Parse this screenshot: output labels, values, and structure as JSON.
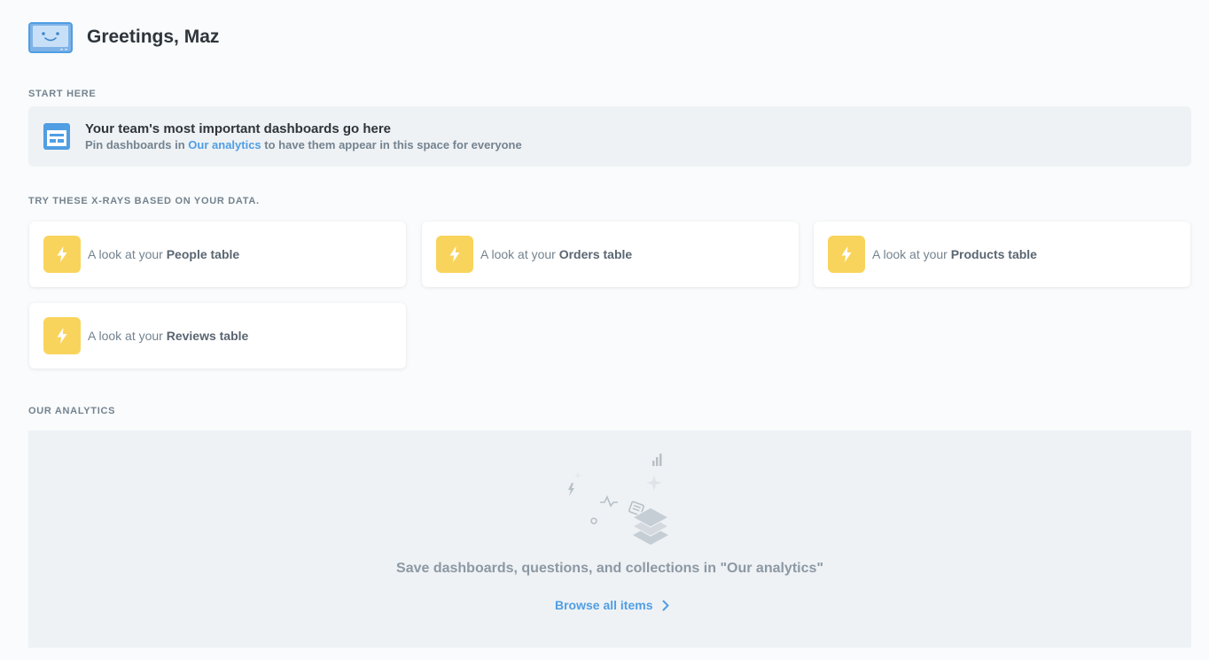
{
  "greeting": {
    "text": "Greetings, Maz",
    "icon": "smiling-screen-icon"
  },
  "start_here": {
    "label": "START HERE",
    "icon": "dashboard-icon",
    "title": "Your team's most important dashboards go here",
    "subtitle_before": "Pin dashboards in ",
    "subtitle_link": "Our analytics",
    "subtitle_after": " to have them appear in this space for everyone"
  },
  "xrays": {
    "label": "TRY THESE X-RAYS BASED ON YOUR DATA.",
    "prefix": "A look at your ",
    "icon": "bolt-icon",
    "items": [
      {
        "table": "People table"
      },
      {
        "table": "Orders table"
      },
      {
        "table": "Products table"
      },
      {
        "table": "Reviews table"
      }
    ]
  },
  "our_analytics": {
    "label": "OUR ANALYTICS",
    "empty_message": "Save dashboards, questions, and collections in \"Our analytics\"",
    "browse_label": "Browse all items",
    "icon": "stacked-layers-icon"
  },
  "colors": {
    "background": "#f9fbfc",
    "accent": "#509ee3",
    "xray_icon_bg": "#f9d45c",
    "panel_bg": "#eef2f5"
  }
}
